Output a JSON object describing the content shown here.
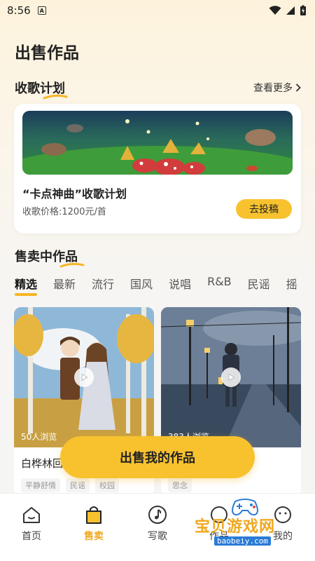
{
  "status": {
    "time": "8:56"
  },
  "page": {
    "title": "出售作品"
  },
  "collect": {
    "section_title": "收歌计划",
    "see_more": "查看更多",
    "card_title": "“卡点神曲”收歌计划",
    "price": "收歌价格:1200元/首",
    "submit_label": "去投稿"
  },
  "selling": {
    "section_title": "售卖中作品",
    "tabs": [
      "精选",
      "最新",
      "流行",
      "国风",
      "说唱",
      "R&B",
      "民谣",
      "摇"
    ],
    "works": [
      {
        "views": "50人浏览",
        "name": "白桦林回",
        "tags": [
          "平静舒情",
          "民谣",
          "校园"
        ]
      },
      {
        "views": "383人浏览",
        "name": "",
        "tags": [
          "",
          "",
          "思念"
        ]
      }
    ]
  },
  "sell_button": "出售我的作品",
  "tabbar": {
    "items": [
      {
        "label": "首页",
        "icon": "home-icon"
      },
      {
        "label": "售卖",
        "icon": "shopping-bag-icon"
      },
      {
        "label": "写歌",
        "icon": "music-note-icon"
      },
      {
        "label": "作品",
        "icon": "works-icon"
      },
      {
        "label": "我的",
        "icon": "profile-icon"
      }
    ]
  },
  "watermark": {
    "text": "宝贝游戏网",
    "url": "baobeiy.com"
  },
  "colors": {
    "accent": "#f8c22f",
    "active_tab": "#f0a81f"
  }
}
